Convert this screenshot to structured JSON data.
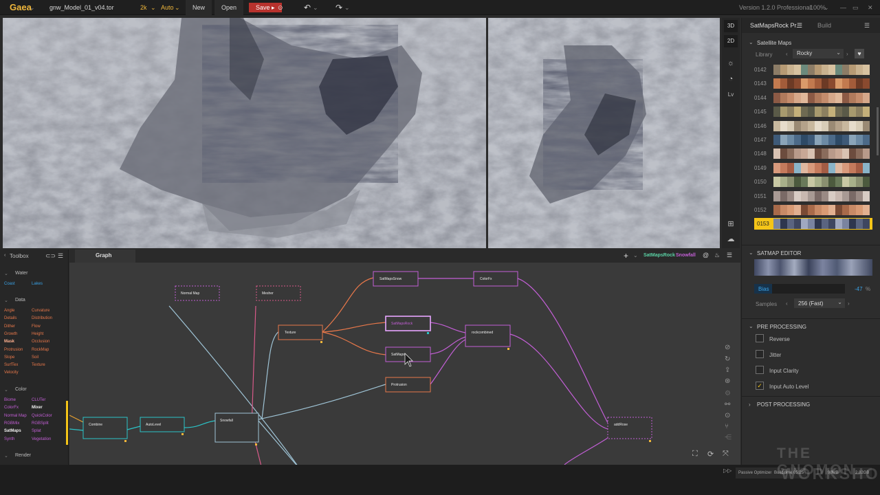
{
  "topbar": {
    "app_name": "Gaea",
    "file_name": "gnw_Model_01_v04.tor",
    "resolution": "2k",
    "mode": "Auto",
    "new_label": "New",
    "open_label": "Open",
    "save_label": "Save",
    "version": "Version 1.2.0 Professional",
    "zoom": "100%"
  },
  "viewport_tools": {
    "view_3d": "3D",
    "view_2d": "2D",
    "lv": "Lv"
  },
  "right_panel": {
    "tab_active": "SatMapsRock Pr...",
    "tab_build": "Build",
    "section_title": "Satellite Maps",
    "library_label": "Library",
    "library_value": "Rocky",
    "satmaps": [
      {
        "num": "0142",
        "colors": [
          "#8c7c66",
          "#c9b28f",
          "#6b8a7c",
          "#b69a74",
          "#d7c2a0"
        ]
      },
      {
        "num": "0143",
        "colors": [
          "#8a4a2f",
          "#c27a4f",
          "#6c3a25",
          "#d99a6a",
          "#a35c3a"
        ]
      },
      {
        "num": "0144",
        "colors": [
          "#b07a5c",
          "#d6a88a",
          "#8c5a45",
          "#c48c6c",
          "#e0b89a"
        ]
      },
      {
        "num": "0145",
        "colors": [
          "#6e6a52",
          "#a89a6e",
          "#c4b07a",
          "#5a5a48",
          "#8c8060"
        ]
      },
      {
        "num": "0146",
        "colors": [
          "#d8cdb8",
          "#b4a28a",
          "#e6dccb",
          "#9a8a74",
          "#c8b89e"
        ]
      },
      {
        "num": "0147",
        "colors": [
          "#3e5a78",
          "#6c8aa4",
          "#2e4a66",
          "#8aa4b8",
          "#4c6a88"
        ]
      },
      {
        "num": "0148",
        "colors": [
          "#b89a8a",
          "#d8c2b2",
          "#8a6c5c",
          "#c8a896",
          "#6c4c3e"
        ]
      },
      {
        "num": "0149",
        "colors": [
          "#c47a5c",
          "#8ab4c8",
          "#d89a7c",
          "#a45c44",
          "#e0b8a0"
        ]
      },
      {
        "num": "0150",
        "colors": [
          "#6a7a5a",
          "#a8b08a",
          "#4c5a3e",
          "#c8c8a4",
          "#8a9070"
        ]
      },
      {
        "num": "0151",
        "colors": [
          "#9a8a84",
          "#c8b8b0",
          "#7a6a66",
          "#d8ccc4",
          "#a89a94"
        ]
      },
      {
        "num": "0152",
        "colors": [
          "#a86a4a",
          "#d89a74",
          "#7a4a34",
          "#c88a66",
          "#e2b090"
        ]
      },
      {
        "num": "0153",
        "colors": [
          "#3e4660",
          "#7a84a0",
          "#5a6480",
          "#a0a8c0",
          "#2e364e"
        ]
      }
    ],
    "editor_title": "SATMAP EDITOR",
    "bias_label": "Bias",
    "bias_value": "-47",
    "bias_unit": "%",
    "bias_fraction": 0.2,
    "samples_label": "Samples",
    "samples_value": "256 (Fast)",
    "pre_processing": "PRE PROCESSING",
    "reverse": "Reverse",
    "jitter": "Jitter",
    "input_clarity": "Input Clarity",
    "input_auto_level": "Input Auto Level",
    "post_processing": "POST PROCESSING"
  },
  "toolbox": {
    "title": "Toolbox",
    "water_head": "Water",
    "water": [
      "Coast",
      "Lakes"
    ],
    "data_head": "Data",
    "data_left": [
      "Angle",
      "Details",
      "Dither",
      "Growth",
      "Mask",
      "Protrusion",
      "Slope",
      "SurfTex",
      "Velocity"
    ],
    "data_right": [
      "Curvature",
      "Distribution",
      "Flow",
      "Height",
      "Occlusion",
      "RockMap",
      "Soil",
      "Texture"
    ],
    "color_head": "Color",
    "color_left": [
      "Biome",
      "ColorFx",
      "Normal Map",
      "RGBMix",
      "SatMaps",
      "Synth"
    ],
    "color_right": [
      "CLUTer",
      "Mixer",
      "QuickColor",
      "RGBSplit",
      "Splat",
      "Vegetation"
    ],
    "render_head": "Render"
  },
  "graph": {
    "tab": "Graph",
    "out1": "SatMapsRock",
    "out2": "Snowfall",
    "nodes": {
      "normal_map": "Normal Map",
      "mesher": "Mesher",
      "texture": "Texture",
      "satmapssnow": "SatMapsSnow",
      "colorfx": "ColorFx",
      "satmapsrock": "SatMapsRock",
      "rockcombined": "rockcombined",
      "satmaps": "SatMaps",
      "protrusion": "Protrusion",
      "combine": "Combine",
      "autolevel": "AutoLevel",
      "snowfall": "Snowfall",
      "addrose": "addRose"
    }
  },
  "status": {
    "passive": "Passive Optimizer",
    "build_time": "Build time 05:25",
    "memory": "90MB",
    "size": "2.82GB"
  },
  "watermark": {
    "line1": "THE GNOMON",
    "line2": "WORKSHOP"
  },
  "colors": {
    "accent": "#f0b73c",
    "node_orange": "#e8784a",
    "node_pink": "#c35fd6",
    "node_cyan": "#2bc4c8",
    "selected": "#f5c518"
  }
}
